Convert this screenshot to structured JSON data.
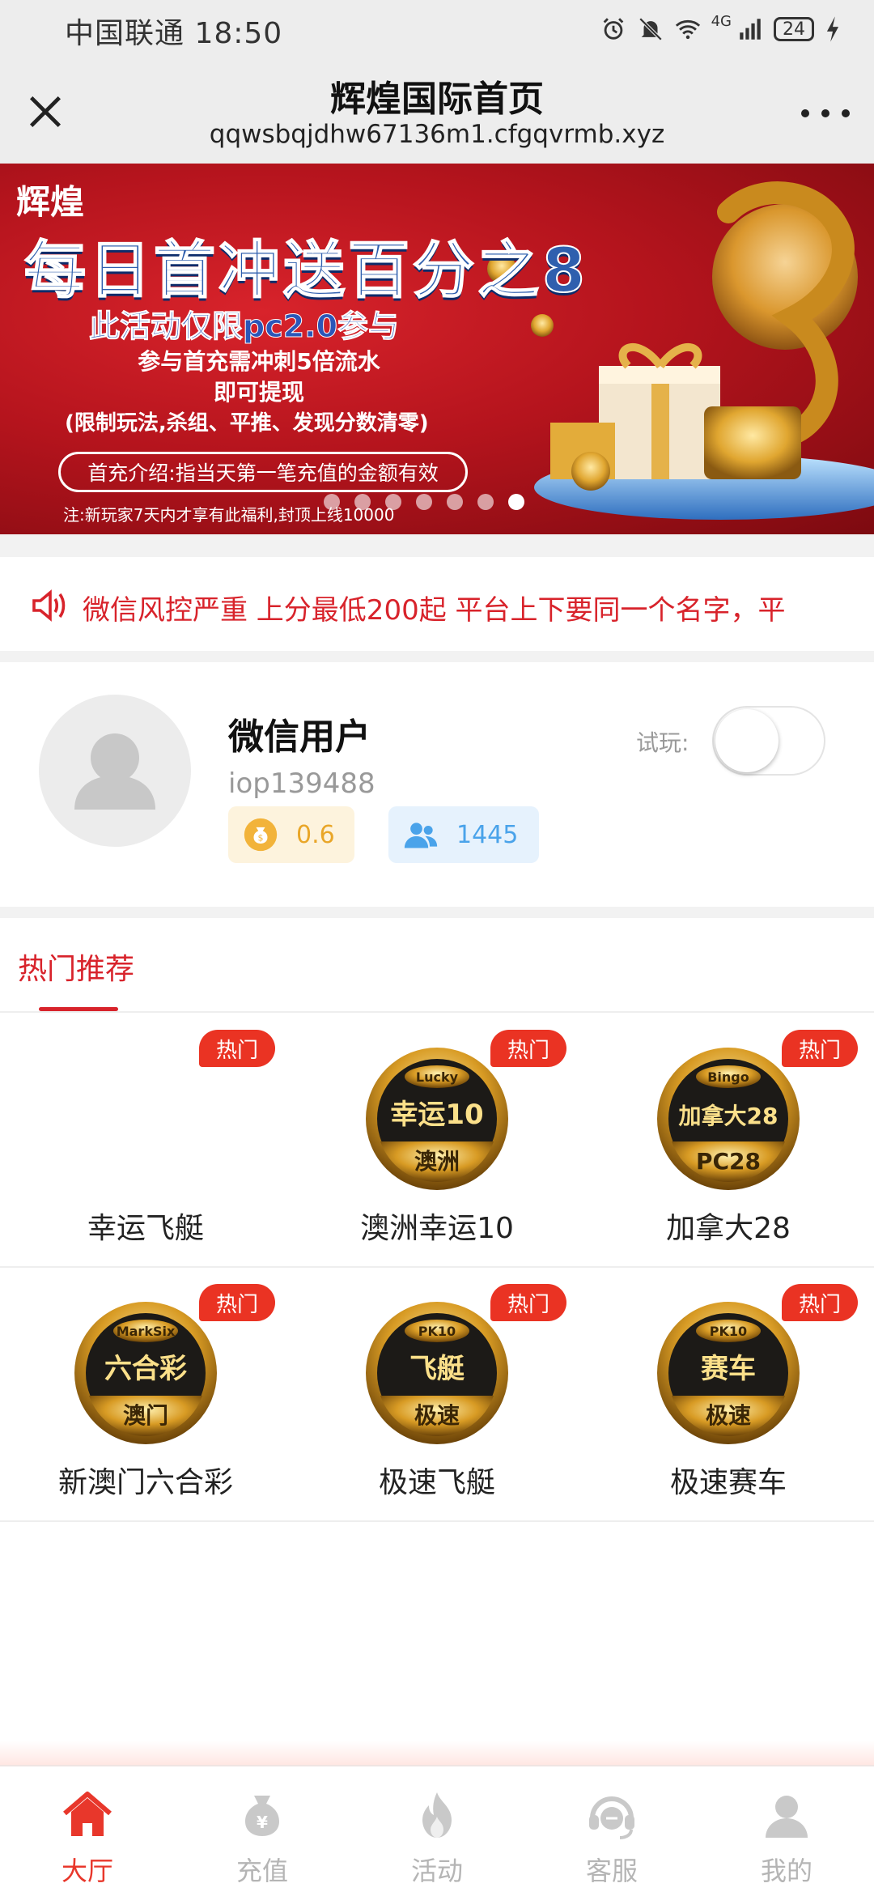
{
  "status_bar": {
    "carrier_time": "中国联通 18:50",
    "network": "4G",
    "battery": "24"
  },
  "title_bar": {
    "title": "辉煌国际首页",
    "url": "qqwsbqjdhw67136m1.cfgqvrmb.xyz"
  },
  "banner": {
    "brand": "辉煌",
    "headline": "每日首冲送百分之8",
    "subtitle": "此活动仅限pc2.0参与",
    "line1": "参与首充需冲刺5倍流水",
    "line2": "即可提现",
    "line3": "(限制玩法,杀组、平推、发现分数清零)",
    "pill": "首充介绍:指当天第一笔充值的金额有效",
    "note": "注:新玩家7天内才享有此福利,封顶上线10000",
    "slides": 7,
    "active_slide": 7
  },
  "notice": {
    "text": "微信风控严重 上分最低200起 平台上下要同一个名字，平"
  },
  "profile": {
    "name": "微信用户",
    "id": "iop139488",
    "balance": "0.6",
    "members": "1445",
    "trial_label": "试玩:",
    "trial_on": false
  },
  "section": {
    "title": "热门推荐"
  },
  "games": [
    {
      "name": "幸运飞艇",
      "badge": "热门",
      "logo": null
    },
    {
      "name": "澳洲幸运10",
      "badge": "热门",
      "logo": {
        "top": "Lucky",
        "mid": "幸运10",
        "bot": "澳洲"
      }
    },
    {
      "name": "加拿大28",
      "badge": "热门",
      "logo": {
        "top": "Bingo",
        "mid": "加拿大28",
        "bot": "PC28"
      }
    },
    {
      "name": "新澳门六合彩",
      "badge": "热门",
      "logo": {
        "top": "MarkSix",
        "mid": "六合彩",
        "bot": "澳门"
      }
    },
    {
      "name": "极速飞艇",
      "badge": "热门",
      "logo": {
        "top": "PK10",
        "mid": "飞艇",
        "bot": "极速"
      }
    },
    {
      "name": "极速赛车",
      "badge": "热门",
      "logo": {
        "top": "PK10",
        "mid": "赛车",
        "bot": "极速"
      }
    }
  ],
  "nav": [
    {
      "label": "大厅",
      "icon": "home-icon",
      "active": true
    },
    {
      "label": "充值",
      "icon": "money-bag-icon",
      "active": false
    },
    {
      "label": "活动",
      "icon": "flame-icon",
      "active": false
    },
    {
      "label": "客服",
      "icon": "headset-icon",
      "active": false
    },
    {
      "label": "我的",
      "icon": "user-icon",
      "active": false
    }
  ],
  "colors": {
    "accent": "#e8372b",
    "inactive": "#b5b5b5",
    "coin": "#e9a628",
    "people": "#4aa3ea"
  }
}
